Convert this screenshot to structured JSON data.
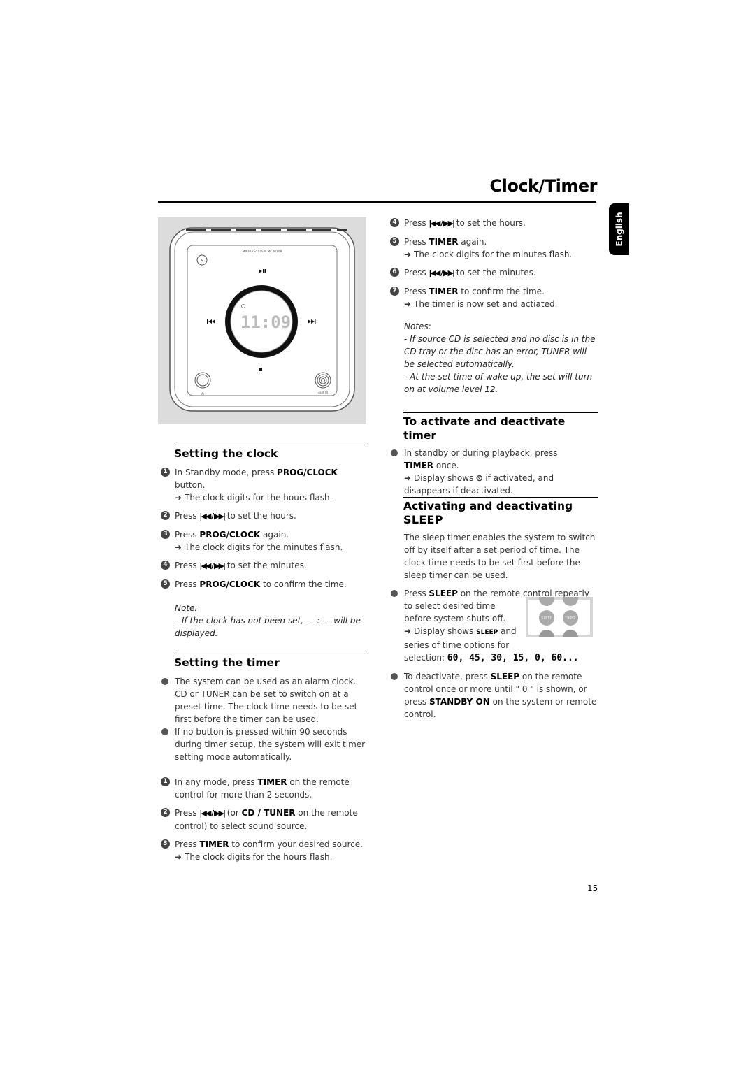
{
  "header": {
    "title": "Clock/Timer",
    "language_tab": "English"
  },
  "device": {
    "brand_line": "MICRO SYSTEM MC M108",
    "display_time": "11:09",
    "aux_label": "AUX IN",
    "icons": [
      "ir-sensor-icon",
      "play-pause-icon",
      "previous-icon",
      "next-icon",
      "stop-icon",
      "headphone-jack-icon",
      "aux-in-jack-icon"
    ]
  },
  "setting_clock": {
    "heading": "Setting the clock",
    "steps": [
      {
        "num": "1",
        "pre": "In Standby mode, press ",
        "bold": "PROG/CLOCK",
        "post": " button.",
        "result": "The clock digits for the hours flash."
      },
      {
        "num": "2",
        "pre": "Press ",
        "transport": "|◀◀ / ▶▶|",
        "post": " to set the hours."
      },
      {
        "num": "3",
        "pre": "Press ",
        "bold": "PROG/CLOCK",
        "post": " again.",
        "result": "The clock digits for the minutes flash."
      },
      {
        "num": "4",
        "pre": "Press ",
        "transport": "|◀◀ / ▶▶|",
        "post": " to set the minutes."
      },
      {
        "num": "5",
        "pre": "Press ",
        "bold": "PROG/CLOCK",
        "post": " to confirm the time."
      }
    ],
    "note_label": "Note:",
    "note_text": "– If the clock has not been set, – –:– – will be displayed."
  },
  "setting_timer": {
    "heading": "Setting the timer",
    "bullets": [
      "The system can be used as an alarm clock. CD or TUNER can be set to switch on at a preset time. The clock time needs to be set first before the timer can be used.",
      "If no button is pressed within 90 seconds during timer setup, the system will exit timer setting mode automatically."
    ],
    "steps": [
      {
        "num": "1",
        "pre": "In any mode, press ",
        "bold": "TIMER",
        "post": " on the remote control for more than 2 seconds."
      },
      {
        "num": "2",
        "pre": "Press ",
        "transport": "|◀◀ / ▶▶|",
        "mid": "  (or ",
        "bold": "CD / TUNER",
        "post": " on the remote control) to select sound source."
      },
      {
        "num": "3",
        "pre": "Press ",
        "bold": "TIMER",
        "post": " to confirm your desired source.",
        "result": "The clock digits for the hours flash."
      },
      {
        "num": "4",
        "pre": "Press ",
        "transport": "|◀◀ / ▶▶|",
        "post": " to set the hours."
      },
      {
        "num": "5",
        "pre": "Press ",
        "bold": "TIMER",
        "post": " again.",
        "result": "The clock digits for the minutes flash."
      },
      {
        "num": "6",
        "pre": "Press ",
        "transport": "|◀◀ / ▶▶|",
        "post": " to set the minutes."
      },
      {
        "num": "7",
        "pre": "Press ",
        "bold": "TIMER",
        "post": " to confirm the time.",
        "result": "The timer is now set and actiated."
      }
    ],
    "notes_label": "Notes:",
    "notes": [
      "- If source CD is selected and no disc is in the CD tray or the disc has an error, TUNER will be selected automatically.",
      "- At the set time of wake up, the set will turn on at volume level 12."
    ]
  },
  "activate_timer": {
    "heading": "To activate and deactivate timer",
    "pre": "In standby or during playback, press ",
    "bold": "TIMER",
    "post": " once.",
    "result_pre": "Display shows ",
    "result_post": " if activated, and disappears if deactivated."
  },
  "sleep": {
    "heading_line1": "Activating and deactivating",
    "heading_line2": "SLEEP",
    "intro": "The sleep timer enables the system to switch off by itself after a set period of time. The clock time needs to be set first before the sleep timer can be used.",
    "b1_pre": "Press ",
    "b1_bold": "SLEEP",
    "b1_post": " on the remote control repeatly to select desired time before system shuts off.",
    "b1_result_pre": "Display shows ",
    "b1_result_bold": "SLEEP",
    "b1_result_post": " and series of time options for selection: ",
    "options": "60, 45, 30, 15, 0, 60...",
    "remote_labels": [
      "SLEEP",
      "TIMER"
    ],
    "b2_pre": "To deactivate, press ",
    "b2_bold": "SLEEP",
    "b2_mid": " on the remote control once or more until \" 0 \" is shown, or press ",
    "b2_bold2": "STANDBY ON",
    "b2_post": " on the system or remote control."
  },
  "footer": {
    "page_number": "15"
  }
}
